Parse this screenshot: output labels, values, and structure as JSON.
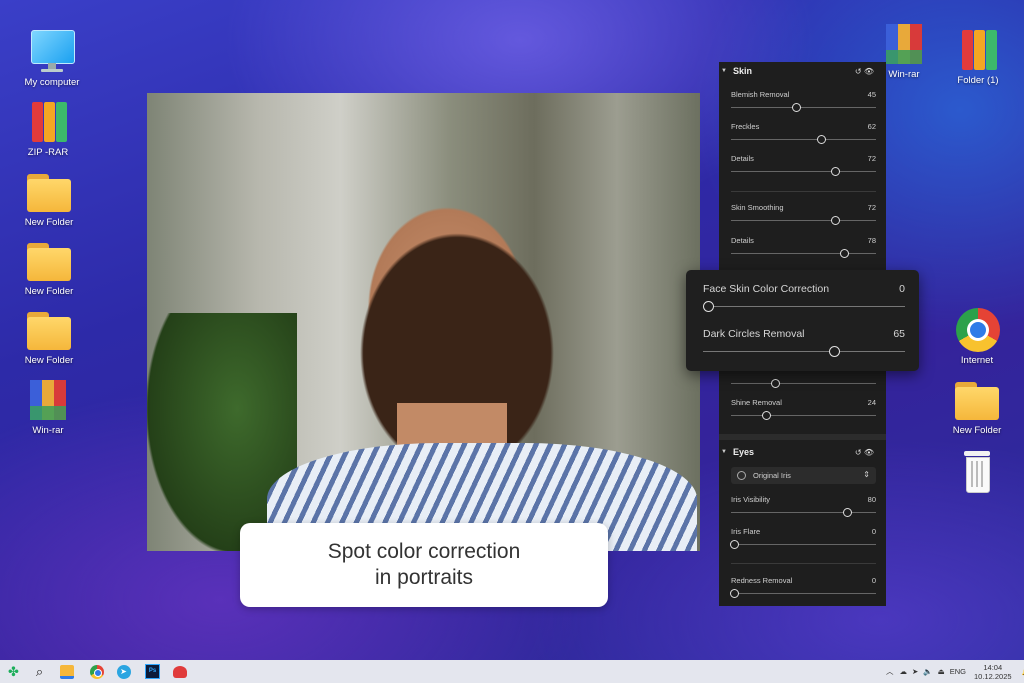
{
  "desktop_left": [
    {
      "label": "My computer"
    },
    {
      "label": "ZIP -RAR"
    },
    {
      "label": "New Folder"
    },
    {
      "label": "New Folder"
    },
    {
      "label": "New Folder"
    },
    {
      "label": "Win-rar"
    }
  ],
  "desktop_right": [
    {
      "label": "Win-rar"
    },
    {
      "label": "Folder (1)"
    },
    {
      "label": "Internet"
    },
    {
      "label": "New Folder"
    }
  ],
  "caption": {
    "line1": "Spot color correction",
    "line2": "in portraits"
  },
  "panel": {
    "skin_title": "Skin",
    "skin_sliders": [
      {
        "name": "Blemish Removal",
        "value": "45"
      },
      {
        "name": "Freckles",
        "value": "62"
      },
      {
        "name": "Details",
        "value": "72"
      },
      {
        "name": "Skin Smoothing",
        "value": "72"
      },
      {
        "name": "Details",
        "value": "78"
      },
      {
        "name": "",
        "value": ""
      },
      {
        "name": "Shine Removal",
        "value": "24"
      }
    ],
    "eyes_title": "Eyes",
    "iris_select": "Original Iris",
    "eyes_sliders": [
      {
        "name": "Iris Visibility",
        "value": "80"
      },
      {
        "name": "Iris Flare",
        "value": "0"
      },
      {
        "name": "Redness Removal",
        "value": "0"
      }
    ]
  },
  "popup": [
    {
      "name": "Face Skin Color Correction",
      "value": "0"
    },
    {
      "name": "Dark Circles Removal",
      "value": "65"
    }
  ],
  "taskbar": {
    "lang": "ENG",
    "time": "14:04",
    "date": "10.12.2025"
  },
  "colors": {
    "panel_bg": "#1e1e1e",
    "taskbar_bg": "#e4e6ee",
    "desktop": "#2d2aa8"
  }
}
